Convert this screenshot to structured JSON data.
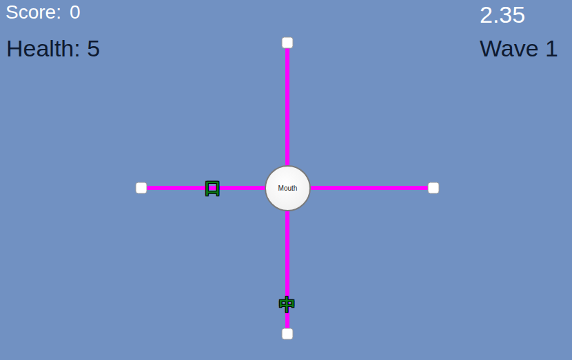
{
  "hud": {
    "score_label": "Score:",
    "score_value": "0",
    "health": "Health: 5",
    "timer": "2.35",
    "wave": "Wave 1"
  },
  "board": {
    "center_label": "Mouth"
  },
  "enemies": [
    {
      "text": "口",
      "kind": "west",
      "level": 0.49
    },
    {
      "text": "中",
      "kind": "south",
      "level": 0.2
    }
  ]
}
